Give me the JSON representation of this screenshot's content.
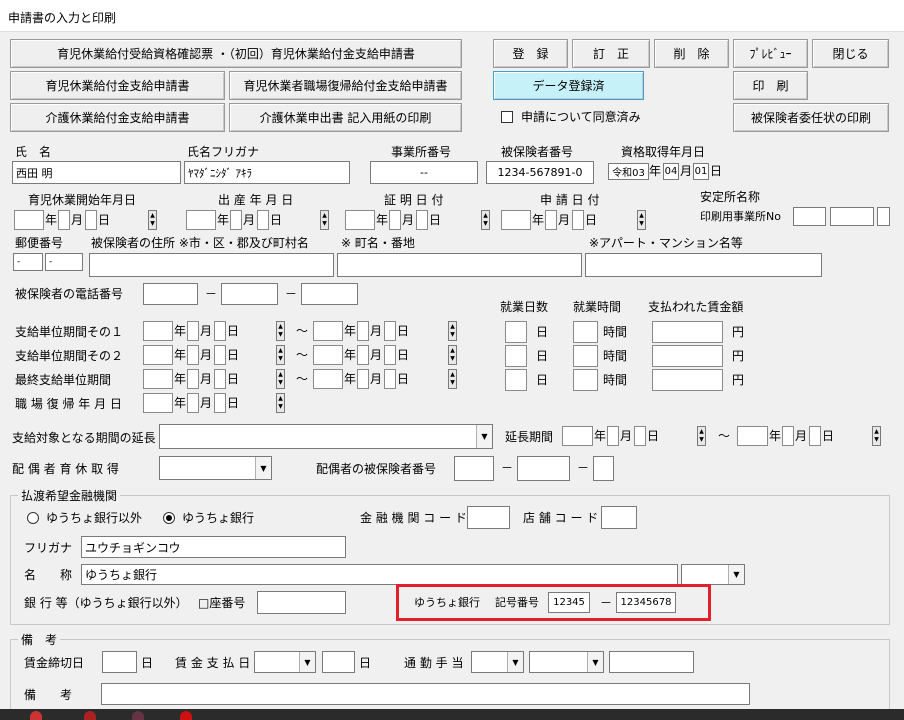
{
  "window": {
    "title": "申請書の入力と印刷"
  },
  "buttons": {
    "b1": "育児休業給付受給資格確認票 ・（初回）育児休業給付金支給申請書",
    "b2": "育児休業給付金支給申請書",
    "b3": "育児休業者職場復帰給付金支給申請書",
    "b4": "介護休業給付金支給申請書",
    "b5": "介護休業申出書 記入用紙の印刷",
    "register": "登　録",
    "correct": "訂　正",
    "delete": "削　除",
    "preview": "ﾌﾟﾚﾋﾞｭｰ",
    "close": "閉じる",
    "data_registered": "データ登録済",
    "print": "印　刷",
    "proxy_print": "被保険者委任状の印刷"
  },
  "consent": {
    "label": "申請について同意済み"
  },
  "fields": {
    "name_label": "氏　名",
    "name_value": "西田 明",
    "kana_label": "氏名フリガナ",
    "kana_value": "ﾔﾏﾀﾞﾆｼﾀﾞ ｱｷﾗ",
    "office_label": "事業所番号",
    "office_value": "--",
    "insured_label": "被保険者番号",
    "insured_value": "1234-567891-0",
    "qualify_label": "資格取得年月日",
    "qualify_era": "令和03",
    "qualify_m": "04",
    "qualify_d": "01"
  },
  "dates": {
    "childcare_start": "育児休業開始年月日",
    "birth": "出 産 年 月 日",
    "cert_date": "証 明 日 付",
    "apply_date": "申 請 日 付",
    "stable_name": "安定所名称",
    "print_office": "印刷用事業所No"
  },
  "units": {
    "y": "年",
    "m": "月",
    "d": "日",
    "yen": "円",
    "days": "日",
    "hours": "時間",
    "tilde": "～",
    "dash": "－",
    "hyphen": "-"
  },
  "address": {
    "postal": "郵便番号",
    "addr1": "被保険者の住所 ※市・区・郡及び町村名",
    "addr2": "※ 町名・番地",
    "addr3": "※アパート・マンション名等"
  },
  "phone": {
    "label": "被保険者の電話番号"
  },
  "periods": {
    "work_days": "就業日数",
    "work_hours": "就業時間",
    "wages": "支払われた賃金額",
    "p1": "支給単位期間その１",
    "p2": "支給単位期間その２",
    "p3": "最終支給単位期間",
    "p4": "職 場 復 帰 年 月 日"
  },
  "extension": {
    "label": "支給対象となる期間の延長",
    "period": "延長期間"
  },
  "spouse": {
    "leave": "配 偶 者 育 休 取 得",
    "number": "配偶者の被保険者番号"
  },
  "bank": {
    "group": "払渡希望金融機関",
    "opt1": "ゆうちょ銀行以外",
    "opt2": "ゆうちょ銀行",
    "code": "金 融 機 関 コ ー ド",
    "branch": "店 舗 コ ー ド",
    "kana_label": "フリガナ",
    "kana_value": "ユウチョギンコウ",
    "name_label": "名　　称",
    "name_value": "ゆうちょ銀行",
    "acct_label": "銀 行 等（ゆうちょ銀行以外）",
    "acct_num": "□座番号",
    "yucho": "ゆうちょ銀行",
    "symbol": "記号番号",
    "sym1": "12345",
    "sym2": "12345678"
  },
  "notes": {
    "group": "備　考",
    "closing": "賃金締切日",
    "payday": "賃 金 支 払 日",
    "commute": "通 勤 手 当",
    "remarks": "備　　考"
  },
  "accent": {
    "highlight": "#e0202a",
    "active": "#c6f1f8"
  }
}
